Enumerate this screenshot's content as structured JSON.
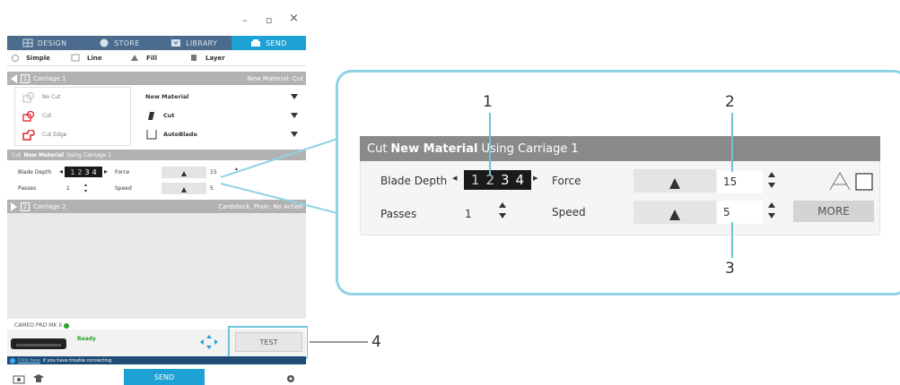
{
  "window": {
    "minimize": "–",
    "maximize": "▫",
    "close": "×"
  },
  "nav": {
    "tabs": [
      {
        "label": "DESIGN",
        "icon": "design-icon",
        "active": false
      },
      {
        "label": "STORE",
        "icon": "store-icon",
        "active": false
      },
      {
        "label": "LIBRARY",
        "icon": "library-icon",
        "active": false
      },
      {
        "label": "SEND",
        "icon": "send-icon",
        "active": true
      }
    ]
  },
  "modes": [
    "Simple",
    "Line",
    "Fill",
    "Layer"
  ],
  "carriage1": {
    "number": "1",
    "label": "Carriage 1",
    "material_summary": "New Material: Cut"
  },
  "actions": [
    "No Cut",
    "Cut",
    "Cut Edge"
  ],
  "selects": {
    "material": "New Material",
    "action": "Cut",
    "tool": "AutoBlade"
  },
  "cut_header": {
    "prefix": "Cut",
    "material": "New Material",
    "suffix": "Using Carriage 1"
  },
  "settings": {
    "blade_depth_label": "Blade Depth",
    "blade_depth_values": [
      "1",
      "2",
      "3",
      "4"
    ],
    "force_label": "Force",
    "force_value": "15",
    "passes_label": "Passes",
    "passes_value": "1",
    "speed_label": "Speed",
    "speed_value": "5",
    "more_label": "MORE"
  },
  "carriage2": {
    "number": "2",
    "label": "Carriage 2",
    "material_summary": "Cardstock, Plain: No Action"
  },
  "machine": {
    "name": "CAMEO PRO MK II",
    "status": "Ready",
    "test_label": "TEST"
  },
  "info": {
    "link": "Click here",
    "text": "if you have trouble connecting."
  },
  "send_label": "SEND",
  "annotations": {
    "n1": "1",
    "n2": "2",
    "n3": "3",
    "n4": "4"
  },
  "colors": {
    "nav_bg": "#4a6b8c",
    "accent": "#1ea1d5",
    "header_gray": "#b2b2b2",
    "callout_border": "#8fd3e4",
    "ready_green": "#2aa12a",
    "cut_red": "#e0202a"
  }
}
